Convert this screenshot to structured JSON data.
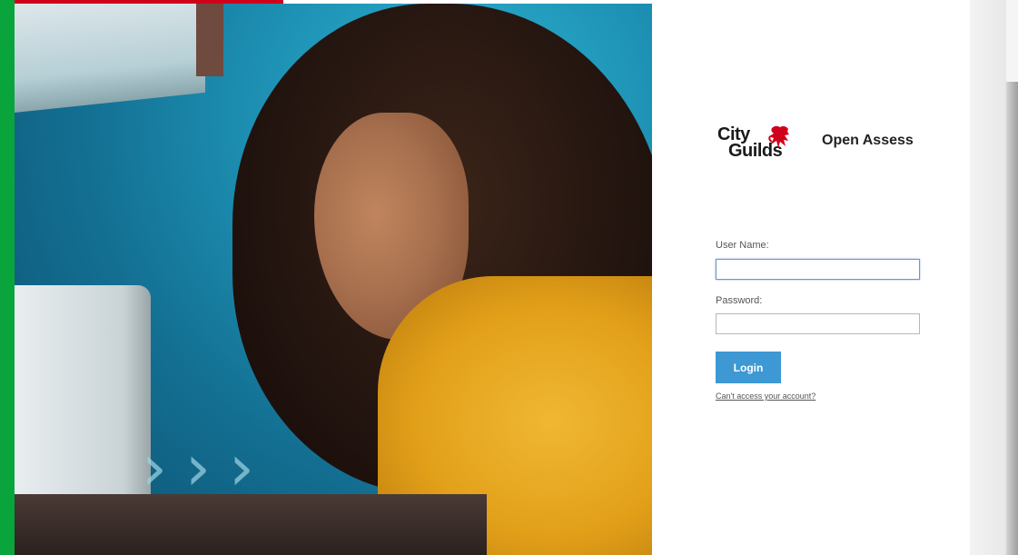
{
  "colors": {
    "brand_green": "#0aa43c",
    "brand_red": "#d0011b",
    "login_button": "#3d98d3"
  },
  "logo": {
    "line1": "City",
    "line2": "Guilds",
    "emblem": "lion-icon"
  },
  "brand_name": "Open Assess",
  "form": {
    "username_label": "User Name:",
    "username_value": "",
    "password_label": "Password:",
    "password_value": "",
    "login_label": "Login",
    "help_link": "Can't access your account?"
  }
}
